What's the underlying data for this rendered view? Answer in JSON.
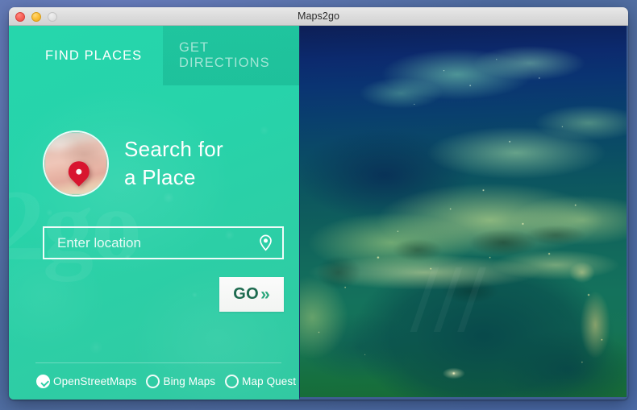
{
  "window": {
    "title": "Maps2go",
    "traffic_lights": [
      {
        "name": "close",
        "color": "#f9655c"
      },
      {
        "name": "minimize",
        "color": "#fdc13b"
      },
      {
        "name": "zoom",
        "color": "#e2e2e2"
      }
    ]
  },
  "theme": {
    "panel_teal": "#2ccfa6",
    "panel_teal_light": "#26d6ac",
    "tab_inactive_overlay": "#0a8c70",
    "go_text": "#1d6a4f",
    "go_chevron": "#2aa77c",
    "pin_red": "#d8152f",
    "desktop_blue": "#52709f"
  },
  "tabs": [
    {
      "label": "FIND PLACES",
      "active": true,
      "name": "tab-find-places"
    },
    {
      "label": "GET DIRECTIONS",
      "active": false,
      "name": "tab-get-directions"
    }
  ],
  "search": {
    "heading_line1": "Search for",
    "heading_line2": "a Place",
    "icon": "map-pin-photo-icon",
    "input_placeholder": "Enter location",
    "input_value": "",
    "input_trailing_icon": "location-pin-icon",
    "go_label": "GO",
    "go_chevron": "»"
  },
  "providers": {
    "selected": "OpenStreetMaps",
    "options": [
      {
        "label": "OpenStreetMaps",
        "checked": true
      },
      {
        "label": "Bing Maps",
        "checked": false
      },
      {
        "label": "Map Quest",
        "checked": false
      }
    ]
  },
  "watermarks": {
    "panel": "2go",
    "map": "///"
  },
  "map_preview": {
    "alt": "satellite-night-view-of-europe"
  }
}
